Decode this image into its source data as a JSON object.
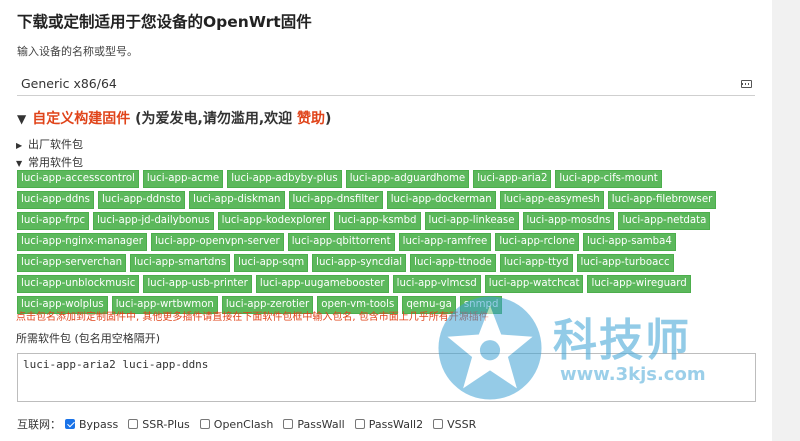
{
  "page": {
    "title": "下载或定制适用于您设备的OpenWrt固件",
    "subtitle": "输入设备的名称或型号。"
  },
  "device": {
    "value": "Generic x86/64",
    "icon": "keyboard-icon"
  },
  "custom_build": {
    "heading_main": "自定义构建固件",
    "heading_suffix": " (为爱发电,请勿滥用,欢迎 ",
    "donate_label": "赞助",
    "heading_close": ")",
    "factory_section": "出厂软件包",
    "common_section": "常用软件包"
  },
  "tags": [
    "luci-app-accesscontrol",
    "luci-app-acme",
    "luci-app-adbyby-plus",
    "luci-app-adguardhome",
    "luci-app-aria2",
    "luci-app-cifs-mount",
    "luci-app-ddns",
    "luci-app-ddnsto",
    "luci-app-diskman",
    "luci-app-dnsfilter",
    "luci-app-dockerman",
    "luci-app-easymesh",
    "luci-app-filebrowser",
    "luci-app-frpc",
    "luci-app-jd-dailybonus",
    "luci-app-kodexplorer",
    "luci-app-ksmbd",
    "luci-app-linkease",
    "luci-app-mosdns",
    "luci-app-netdata",
    "luci-app-nginx-manager",
    "luci-app-openvpn-server",
    "luci-app-qbittorrent",
    "luci-app-ramfree",
    "luci-app-rclone",
    "luci-app-samba4",
    "luci-app-serverchan",
    "luci-app-smartdns",
    "luci-app-sqm",
    "luci-app-syncdial",
    "luci-app-ttnode",
    "luci-app-ttyd",
    "luci-app-turboacc",
    "luci-app-unblockmusic",
    "luci-app-usb-printer",
    "luci-app-uugamebooster",
    "luci-app-vlmcsd",
    "luci-app-watchcat",
    "luci-app-wireguard",
    "luci-app-wolplus",
    "luci-app-wrtbwmon",
    "luci-app-zerotier",
    "open-vm-tools",
    "qemu-ga",
    "snmpd"
  ],
  "note": "点击包名添加到定制固件中, 其他更多插件请直接在下面软件包框中输入包名, 包含市面上几乎所有开源插件",
  "packages": {
    "label": "所需软件包 (包名用空格隔开)",
    "value": "luci-app-aria2 luci-app-ddns"
  },
  "network": {
    "label": "互联网：",
    "options": [
      {
        "label": "Bypass",
        "checked": true
      },
      {
        "label": "SSR-Plus",
        "checked": false
      },
      {
        "label": "OpenClash",
        "checked": false
      },
      {
        "label": "PassWall",
        "checked": false
      },
      {
        "label": "PassWall2",
        "checked": false
      },
      {
        "label": "VSSR",
        "checked": false
      }
    ]
  },
  "watermark": {
    "text": "科技师",
    "url": "www.3kjs.com"
  },
  "colors": {
    "tag_bg": "#5cb85c",
    "accent_orange": "#e0441a",
    "checkbox_blue": "#1a73e8"
  }
}
